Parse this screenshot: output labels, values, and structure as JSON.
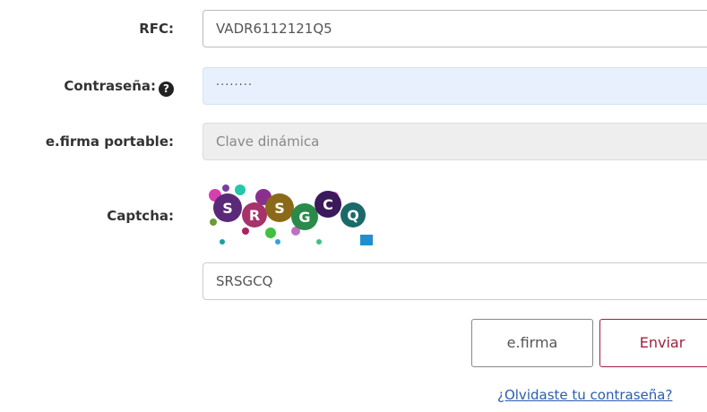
{
  "form": {
    "rfc": {
      "label": "RFC:",
      "value": "VADR6112121Q5"
    },
    "password": {
      "label": "Contraseña:",
      "help_icon": "question-circle-icon",
      "value": "········"
    },
    "portable": {
      "label": "e.firma portable:",
      "placeholder": "Clave dinámica"
    },
    "captcha": {
      "label": "Captcha:",
      "image_text": "SRSGCQ",
      "value": "SRSGCQ"
    }
  },
  "buttons": {
    "efirma": "e.firma",
    "enviar": "Enviar"
  },
  "forgot_link": "¿Olvidaste tu contraseña?",
  "colors": {
    "accent": "#a02040",
    "link": "#2a5db0",
    "autofill": "#e8f0fe"
  }
}
